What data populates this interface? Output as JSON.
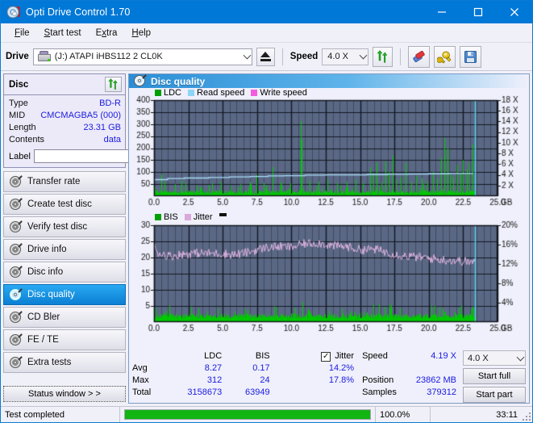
{
  "window": {
    "title": "Opti Drive Control 1.70",
    "icon": "optical-disc-icon",
    "minimize": "minimize-icon",
    "maximize": "maximize-icon",
    "close": "close-icon"
  },
  "menu": {
    "items": [
      "File",
      "Start test",
      "Extra",
      "Help"
    ]
  },
  "toolbar": {
    "drive_label": "Drive",
    "drive_value": "(J:)  ATAPI iHBS112  2 CL0K",
    "eject_icon": "eject-icon",
    "speed_label": "Speed",
    "speed_value": "4.0 X",
    "refresh_icon": "refresh-icon",
    "erase_icon": "eraser-icon",
    "tools_icon": "wrench-icon",
    "save_icon": "save-icon"
  },
  "disc": {
    "header": "Disc",
    "refresh_icon": "refresh-disc-icon",
    "rows": [
      {
        "key": "Type",
        "value": "BD-R"
      },
      {
        "key": "MID",
        "value": "CMCMAGBA5 (000)"
      },
      {
        "key": "Length",
        "value": "23.31 GB"
      },
      {
        "key": "Contents",
        "value": "data"
      }
    ],
    "label_key": "Label",
    "label_value": "",
    "label_placeholder": "",
    "label_icon": "disc-icon"
  },
  "nav": {
    "items": [
      {
        "label": "Transfer rate",
        "active": false
      },
      {
        "label": "Create test disc",
        "active": false
      },
      {
        "label": "Verify test disc",
        "active": false
      },
      {
        "label": "Drive info",
        "active": false
      },
      {
        "label": "Disc info",
        "active": false
      },
      {
        "label": "Disc quality",
        "active": true
      },
      {
        "label": "CD Bler",
        "active": false
      },
      {
        "label": "FE / TE",
        "active": false
      },
      {
        "label": "Extra tests",
        "active": false
      }
    ],
    "status_window": "Status window > >"
  },
  "panel": {
    "title": "Disc quality",
    "icon": "disc-quality-icon"
  },
  "chart_data": [
    {
      "type": "line",
      "name": "LDC / speed chart",
      "legend": [
        {
          "label": "LDC",
          "color": "#00a000"
        },
        {
          "label": "Read speed",
          "color": "#8ed4f5"
        },
        {
          "label": "Write speed",
          "color": "#f35ce0"
        }
      ],
      "legend_position": "top-left",
      "xlabel": "GB",
      "xlim": [
        0,
        25
      ],
      "xticks": [
        "0.0",
        "2.5",
        "5.0",
        "7.5",
        "10.0",
        "12.5",
        "15.0",
        "17.5",
        "20.0",
        "22.5",
        "25.0"
      ],
      "ylabel_left": "",
      "ylim_left": [
        0,
        400
      ],
      "yticks_left": [
        "400",
        "350",
        "300",
        "250",
        "200",
        "150",
        "100",
        "50"
      ],
      "ylabel_right": "X",
      "ylim_right": [
        0,
        18
      ],
      "yticks_right": [
        "18 X",
        "16 X",
        "14 X",
        "12 X",
        "10 X",
        "8 X",
        "6 X",
        "4 X",
        "2 X"
      ],
      "grid": true,
      "data_end_gb": 23.4,
      "series": [
        {
          "name": "LDC",
          "color": "#00c800",
          "type": "area-spikes",
          "baseline": 22,
          "noise_amp": 14,
          "spikes": [
            [
              0.55,
              90
            ],
            [
              0.75,
              60
            ],
            [
              1.5,
              50
            ],
            [
              2.0,
              65
            ],
            [
              2.3,
              55
            ],
            [
              3.1,
              45
            ],
            [
              4.2,
              55
            ],
            [
              4.9,
              60
            ],
            [
              5.6,
              45
            ],
            [
              6.3,
              50
            ],
            [
              7.0,
              60
            ],
            [
              7.45,
              90
            ],
            [
              8.0,
              55
            ],
            [
              8.6,
              120
            ],
            [
              9.2,
              60
            ],
            [
              9.9,
              55
            ],
            [
              10.7,
              312
            ],
            [
              10.75,
              235
            ],
            [
              11.3,
              65
            ],
            [
              12.0,
              60
            ],
            [
              12.6,
              70
            ],
            [
              13.3,
              55
            ],
            [
              14.0,
              60
            ],
            [
              14.7,
              70
            ],
            [
              15.2,
              55
            ],
            [
              15.7,
              120
            ],
            [
              15.95,
              95
            ],
            [
              16.2,
              140
            ],
            [
              16.55,
              60
            ],
            [
              16.85,
              145
            ],
            [
              17.05,
              100
            ],
            [
              17.35,
              170
            ],
            [
              17.6,
              70
            ],
            [
              17.95,
              80
            ],
            [
              18.3,
              140
            ],
            [
              18.7,
              60
            ],
            [
              19.1,
              85
            ],
            [
              19.5,
              75
            ],
            [
              19.9,
              60
            ],
            [
              20.3,
              100
            ],
            [
              20.6,
              75
            ],
            [
              20.9,
              160
            ],
            [
              21.15,
              240
            ],
            [
              21.35,
              200
            ],
            [
              21.55,
              90
            ],
            [
              21.8,
              80
            ],
            [
              22.05,
              130
            ],
            [
              22.3,
              95
            ],
            [
              22.5,
              150
            ],
            [
              22.75,
              110
            ],
            [
              22.95,
              140
            ],
            [
              23.2,
              215
            ]
          ]
        },
        {
          "name": "Read speed",
          "color": "#a8ddf8",
          "type": "step-line",
          "points": [
            [
              0.0,
              3.1
            ],
            [
              1.0,
              3.3
            ],
            [
              2.2,
              3.4
            ],
            [
              4.0,
              3.5
            ],
            [
              5.5,
              3.6
            ],
            [
              7.0,
              3.7
            ],
            [
              8.3,
              3.8
            ],
            [
              9.5,
              3.85
            ],
            [
              11.0,
              3.95
            ],
            [
              12.5,
              4.0
            ],
            [
              14.0,
              4.0
            ],
            [
              15.5,
              4.05
            ],
            [
              17.0,
              4.1
            ],
            [
              18.5,
              4.15
            ],
            [
              20.0,
              4.2
            ],
            [
              21.5,
              4.25
            ],
            [
              23.2,
              4.3
            ]
          ]
        },
        {
          "name": "cursor",
          "color": "#4fd8f5",
          "type": "vline",
          "x": 23.35
        }
      ]
    },
    {
      "type": "line",
      "name": "BIS / jitter chart",
      "legend": [
        {
          "label": "BIS",
          "color": "#00a000"
        },
        {
          "label": "Jitter",
          "color": "#dba8dd"
        }
      ],
      "legend_position": "top-left",
      "xlabel": "GB",
      "xlim": [
        0,
        25
      ],
      "xticks": [
        "0.0",
        "2.5",
        "5.0",
        "7.5",
        "10.0",
        "12.5",
        "15.0",
        "17.5",
        "20.0",
        "22.5",
        "25.0"
      ],
      "ylim_left": [
        0,
        30
      ],
      "yticks_left": [
        "30",
        "25",
        "20",
        "15",
        "10",
        "5"
      ],
      "ylim_right": [
        0,
        20
      ],
      "yticks_right": [
        "20%",
        "16%",
        "12%",
        "8%",
        "4%"
      ],
      "grid": true,
      "data_end_gb": 23.4,
      "series": [
        {
          "name": "BIS",
          "color": "#00c800",
          "type": "area-spikes",
          "baseline": 2.6,
          "noise_amp": 1.5,
          "spikes": [
            [
              6.6,
              4.2
            ],
            [
              10.8,
              6.2
            ],
            [
              17.2,
              4.2
            ],
            [
              21.0,
              4.3
            ],
            [
              23.25,
              4.4
            ]
          ]
        },
        {
          "name": "Jitter",
          "color": "#dfb3e0",
          "type": "noisy-line",
          "anchors": [
            [
              0.0,
              23.5
            ],
            [
              0.3,
              21.5
            ],
            [
              1.2,
              20.4
            ],
            [
              2.0,
              21.0
            ],
            [
              3.0,
              21.4
            ],
            [
              4.0,
              21.3
            ],
            [
              5.0,
              21.2
            ],
            [
              6.0,
              20.9
            ],
            [
              7.0,
              21.8
            ],
            [
              8.0,
              23.0
            ],
            [
              9.0,
              23.4
            ],
            [
              10.0,
              23.2
            ],
            [
              11.0,
              24.3
            ],
            [
              12.0,
              24.5
            ],
            [
              13.0,
              23.6
            ],
            [
              14.0,
              23.4
            ],
            [
              15.0,
              22.4
            ],
            [
              16.0,
              22.6
            ],
            [
              17.0,
              21.6
            ],
            [
              18.0,
              20.6
            ],
            [
              19.0,
              20.2
            ],
            [
              20.0,
              19.8
            ],
            [
              21.0,
              19.3
            ],
            [
              22.0,
              19.0
            ],
            [
              23.2,
              18.6
            ]
          ],
          "noise_amp": 1.4
        },
        {
          "name": "cursor",
          "color": "#4fd8f5",
          "type": "vline",
          "x": 23.35
        }
      ]
    }
  ],
  "stats": {
    "col_headers": [
      "LDC",
      "BIS"
    ],
    "row_headers": [
      "Avg",
      "Max",
      "Total"
    ],
    "ldc": {
      "avg": "8.27",
      "max": "312",
      "total": "3158673"
    },
    "bis": {
      "avg": "0.17",
      "max": "24",
      "total": "63949"
    },
    "jitter": {
      "label": "Jitter",
      "checked": true,
      "avg": "14.2%",
      "max": "17.8%"
    },
    "speed_label": "Speed",
    "speed_value": "4.19 X",
    "position_label": "Position",
    "position_value": "23862 MB",
    "samples_label": "Samples",
    "samples_value": "379312",
    "speed_select": "4.0 X",
    "start_full": "Start full",
    "start_part": "Start part"
  },
  "statusbar": {
    "message": "Test completed",
    "progress_percent": 100,
    "progress_text": "100.0%",
    "elapsed": "33:11"
  },
  "colors": {
    "accent": "#0078d7",
    "plot_bg": "#5a6885",
    "green": "#00c800",
    "value_blue": "#1b1be0",
    "cursor": "#4fd8f5"
  }
}
